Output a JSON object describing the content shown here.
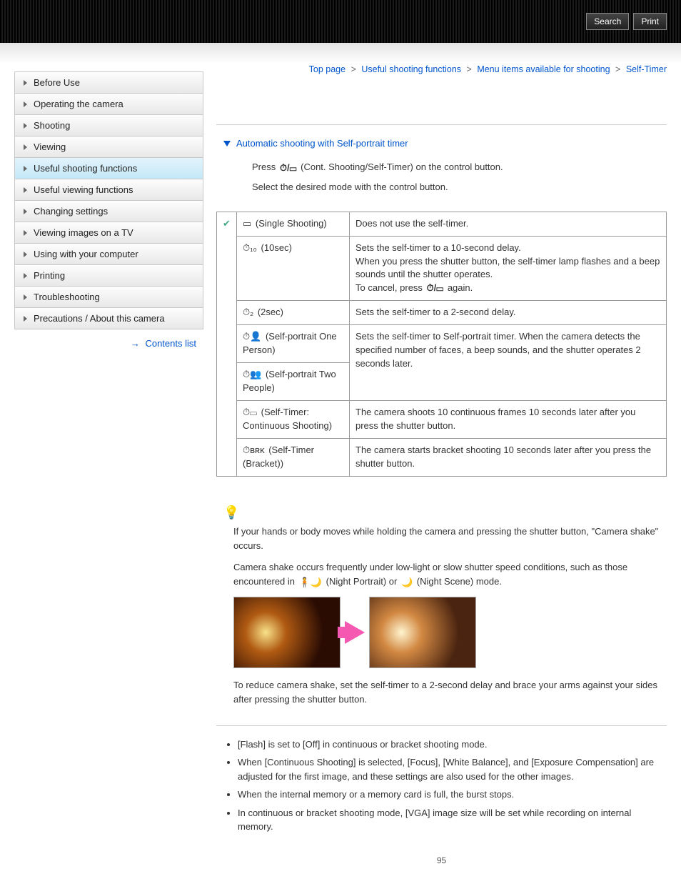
{
  "header": {
    "search": "Search",
    "print": "Print"
  },
  "breadcrumb": {
    "items": [
      "Top page",
      "Useful shooting functions",
      "Menu items available for shooting",
      "Self-Timer"
    ]
  },
  "sidebar": {
    "items": [
      "Before Use",
      "Operating the camera",
      "Shooting",
      "Viewing",
      "Useful shooting functions",
      "Useful viewing functions",
      "Changing settings",
      "Viewing images on a TV",
      "Using with your computer",
      "Printing",
      "Troubleshooting",
      "Precautions / About this camera"
    ],
    "active_index": 4,
    "contents_list": "Contents list"
  },
  "anchor": {
    "label": "Automatic shooting with Self-portrait timer"
  },
  "steps": {
    "line1a": "Press ",
    "line1b": "(Cont. Shooting/Self-Timer) on the control button.",
    "line2": "Select the desired mode with the control button."
  },
  "icons": {
    "timer_burst": "⏱/▭",
    "single": "▭",
    "t10": "⏱₁₀",
    "t2": "⏱₂",
    "p1": "⏱👤",
    "p2": "⏱👥",
    "cont": "⏱▭",
    "brk": "⏱ʙʀᴋ",
    "night_portrait": "🧍🌙",
    "night_scene": "🌙",
    "hint": "💡"
  },
  "table": {
    "check": "✔",
    "rows": [
      {
        "mode": "(Single Shooting)",
        "desc": "Does not use the self-timer."
      },
      {
        "mode": "(10sec)",
        "desc_a": "Sets the self-timer to a 10-second delay.\nWhen you press the shutter button, the self-timer lamp flashes and a beep sounds until the shutter operates.\nTo cancel, press ",
        "desc_b": "again."
      },
      {
        "mode": "(2sec)",
        "desc": "Sets the self-timer to a 2-second delay."
      },
      {
        "mode": "(Self-portrait One Person)",
        "desc": "Sets the self-timer to Self-portrait timer.\nWhen the camera detects the specified number of faces, a beep sounds, and the shutter operates 2 seconds later."
      },
      {
        "mode": "(Self-portrait Two People)"
      },
      {
        "mode": "(Self-Timer: Continuous Shooting)",
        "desc": "The camera shoots 10 continuous frames 10 seconds later after you press the shutter button."
      },
      {
        "mode": "(Self-Timer (Bracket))",
        "desc": "The camera starts bracket shooting 10 seconds later after you press the shutter button."
      }
    ]
  },
  "tip": {
    "p1": "If your hands or body moves while holding the camera and pressing the shutter button, \"Camera shake\" occurs.",
    "p2a": "Camera shake occurs frequently under low-light or slow shutter speed conditions, such as those encountered in ",
    "p2b": "(Night Portrait) or ",
    "p2c": "(Night Scene) mode.",
    "p3": "To reduce camera shake, set the self-timer to a 2-second delay and brace your arms against your sides after pressing the shutter button."
  },
  "notes": [
    "[Flash] is set to [Off] in continuous or bracket shooting mode.",
    "When [Continuous Shooting] is selected, [Focus], [White Balance], and [Exposure Compensation] are adjusted for the first image, and these settings are also used for the other images.",
    "When the internal memory or a memory card is full, the burst stops.",
    "In continuous or bracket shooting mode, [VGA] image size will be set while recording on internal memory."
  ],
  "page_number": "95"
}
